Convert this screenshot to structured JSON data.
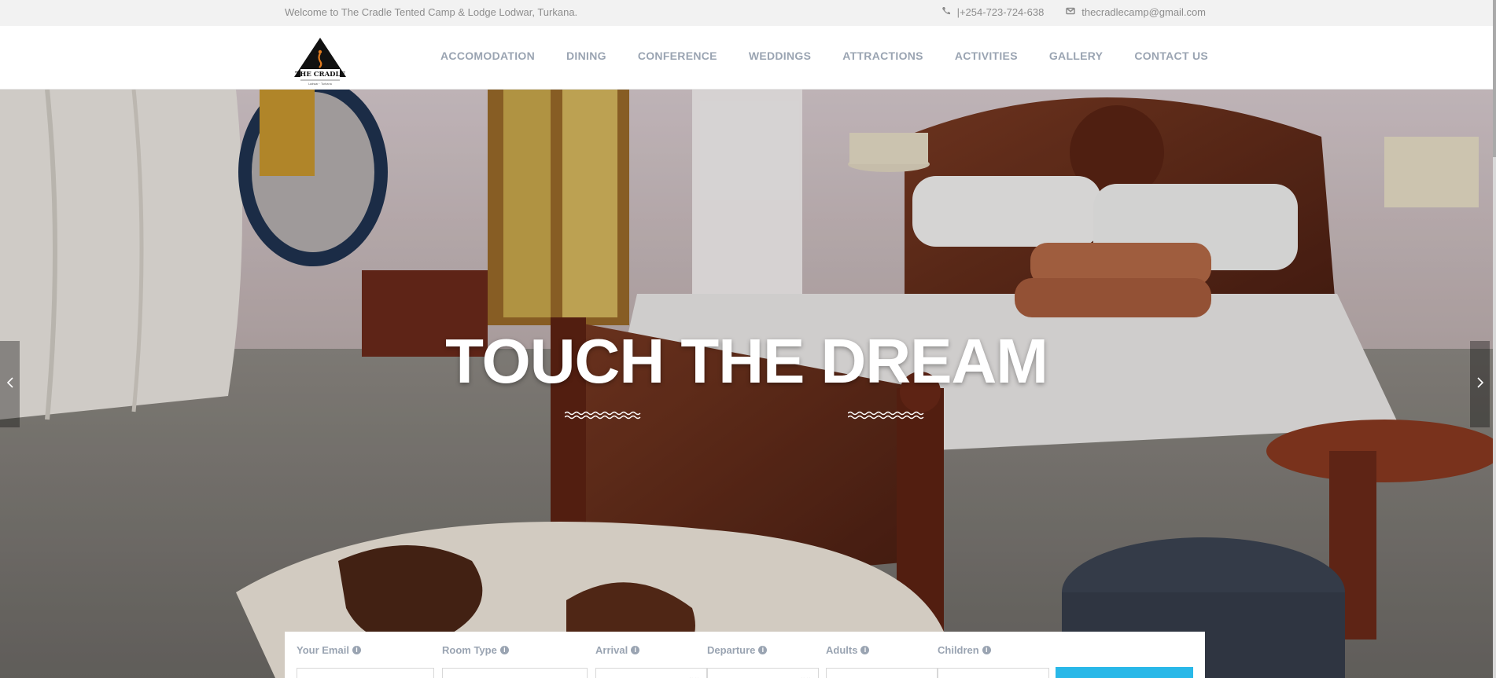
{
  "topbar": {
    "welcome": "Welcome to The Cradle Tented Camp & Lodge Lodwar, Turkana.",
    "phone": "|+254-723-724-638",
    "email": "thecradlecamp@gmail.com",
    "phone_icon": "phone-icon",
    "email_icon": "envelope-icon"
  },
  "logo": {
    "text": "THE CRADLE",
    "subtext": "Lodwar · Turkana"
  },
  "nav": {
    "items": [
      {
        "label": "ACCOMODATION"
      },
      {
        "label": "DINING"
      },
      {
        "label": "CONFERENCE"
      },
      {
        "label": "WEDDINGS"
      },
      {
        "label": "ATTRACTIONS"
      },
      {
        "label": "ACTIVITIES"
      },
      {
        "label": "GALLERY"
      },
      {
        "label": "CONTACT US"
      }
    ]
  },
  "hero": {
    "headline": "TOUCH THE DREAM",
    "prev_icon": "chevron-left-icon",
    "next_icon": "chevron-right-icon"
  },
  "booking": {
    "fields": [
      {
        "label": "Your Email"
      },
      {
        "label": "Room Type"
      },
      {
        "label": "Arrival"
      },
      {
        "label": "Departure"
      },
      {
        "label": "Adults"
      },
      {
        "label": "Children"
      }
    ],
    "info_icon": "info-circle-icon"
  },
  "colors": {
    "nav_text": "#9aa4b2",
    "book_button": "#29b8e8",
    "topbar_bg": "#f2f2f2"
  }
}
